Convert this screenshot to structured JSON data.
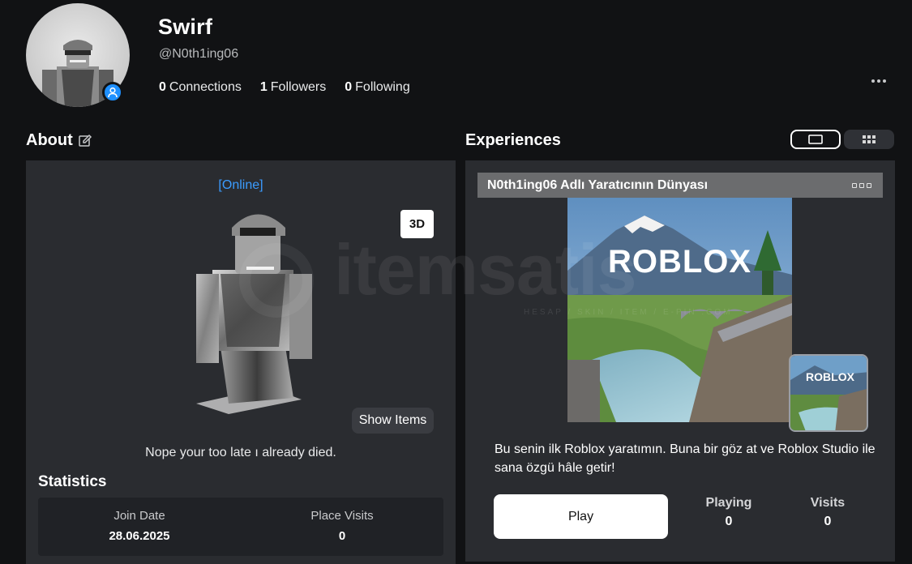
{
  "profile": {
    "display_name": "Swirf",
    "username": "@N0th1ing06",
    "connections_count": "0",
    "connections_label": "Connections",
    "followers_count": "1",
    "followers_label": "Followers",
    "following_count": "0",
    "following_label": "Following"
  },
  "about": {
    "title": "About",
    "status": "[Online]",
    "btn_3d": "3D",
    "show_items": "Show Items",
    "blurb": "Nope your too late ı already died."
  },
  "statistics": {
    "title": "Statistics",
    "items": [
      {
        "label": "Join Date",
        "value": "28.06.2025"
      },
      {
        "label": "Place Visits",
        "value": "0"
      }
    ]
  },
  "experiences": {
    "title": "Experiences",
    "card": {
      "name": "N0th1ing06 Adlı Yaratıcının Dünyası",
      "thumb_logo": "ROBLOX",
      "description": "Bu senin ilk Roblox yaratımın. Buna bir göz at ve Roblox Studio ile sana özgü hâle getir!",
      "play_label": "Play",
      "playing_label": "Playing",
      "playing_value": "0",
      "visits_label": "Visits",
      "visits_value": "0"
    }
  },
  "watermark": {
    "text": "itemsatis",
    "subtext": "HESAP / SKIN / ITEM / E-PIN .COM"
  },
  "icons": {
    "presence": "user-icon",
    "edit": "edit-icon",
    "more": "more-horizontal-icon",
    "view_large": "single-view-icon",
    "view_grid": "grid-view-icon"
  },
  "colors": {
    "background": "#111214",
    "panel": "#2a2c30",
    "online": "#3b9cff",
    "presence_badge": "#1e90ff"
  }
}
